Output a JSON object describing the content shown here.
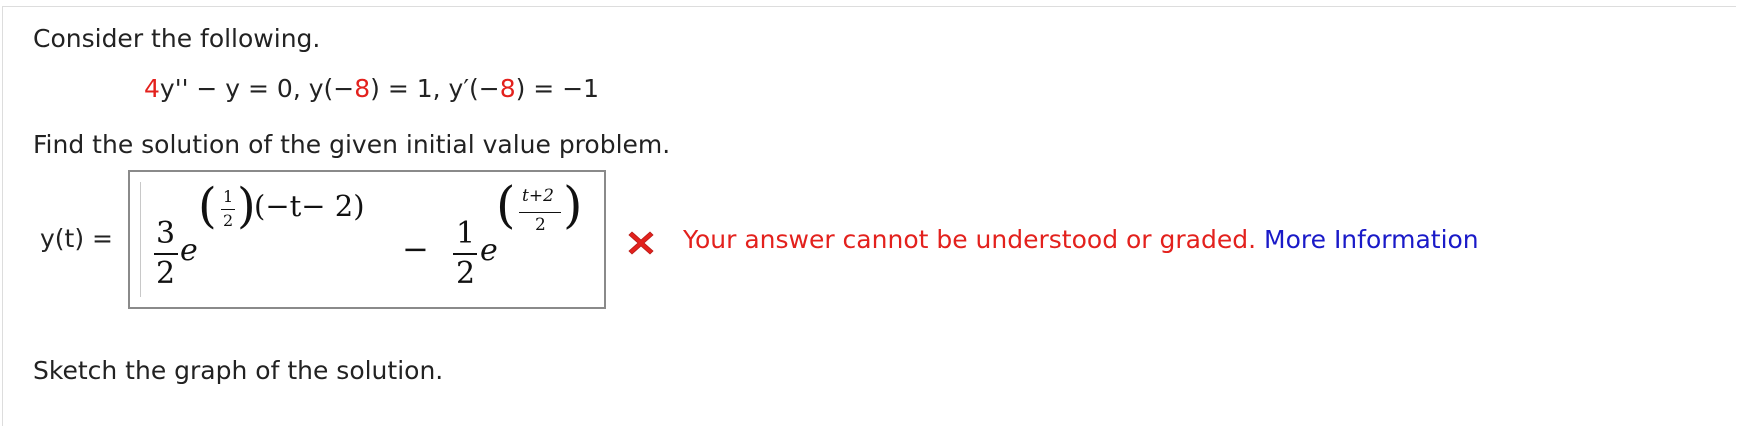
{
  "question": {
    "intro": "Consider the following.",
    "equation": {
      "part1_coef": "4",
      "part1_rest": "y'' − y = 0,   y(−",
      "point1": "8",
      "part2": ") = 1,   y′(−",
      "point2": "8",
      "part3": ") = −1"
    },
    "prompt": "Find the solution of the given initial value problem.",
    "sketch_prompt": "Sketch the graph of the solution."
  },
  "answer": {
    "label": "y(t)  =",
    "term1": {
      "numerator": "3",
      "denominator": "2",
      "base": "e",
      "exp_open": "(",
      "exp_frac_num": "1",
      "exp_frac_den": "2",
      "exp_close": ")",
      "exp_factor": "(−t− 2)"
    },
    "operator": "−",
    "term2": {
      "numerator": "1",
      "denominator": "2",
      "base": "e",
      "exp_open": "(",
      "exp_frac_num": "t+2",
      "exp_frac_den": "2",
      "exp_close": ")"
    }
  },
  "feedback": {
    "status_icon": "x-mark-icon",
    "message": "Your answer cannot be understood or graded.",
    "link_label": "More Information",
    "colors": {
      "error": "#e3211d",
      "link": "#1a1ac8"
    }
  }
}
